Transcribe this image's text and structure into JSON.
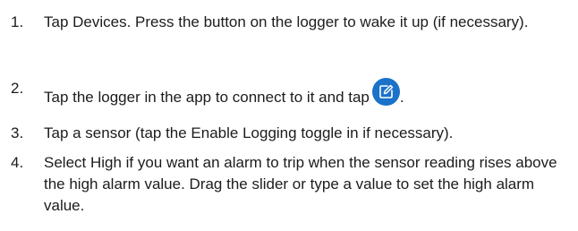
{
  "steps": [
    {
      "number": "1.",
      "text": "Tap Devices. Press the button on the logger to wake it up (if necessary)."
    },
    {
      "number": "2.",
      "text_before_icon": "Tap the logger in the app to connect to it and tap",
      "icon": "edit-icon",
      "text_after_icon": ".",
      "icon_color": "#1a72c9"
    },
    {
      "number": "3.",
      "text": "Tap a sensor (tap the Enable Logging toggle in if necessary)."
    },
    {
      "number": "4.",
      "text": "Select High if you want an alarm to trip when the sensor reading rises above the high alarm value. Drag the slider or type a value to set the high alarm value."
    }
  ]
}
